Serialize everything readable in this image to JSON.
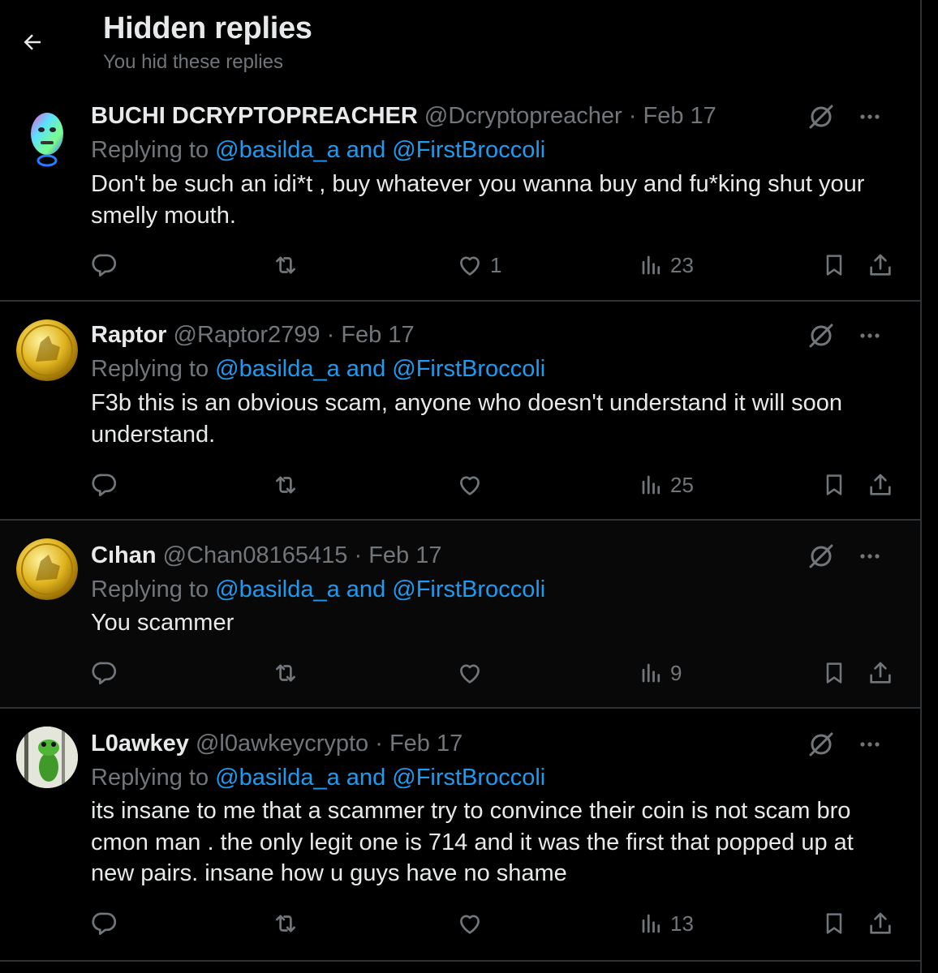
{
  "header": {
    "title": "Hidden replies",
    "subtitle": "You hid these replies",
    "back_icon": "arrow-left-icon"
  },
  "colors": {
    "background": "#000000",
    "text": "#e7e9ea",
    "muted": "#71767b",
    "link": "#1d9bf0",
    "divider": "#2f3336"
  },
  "replies": [
    {
      "name": "BUCHI DCRYPTOPREACHER",
      "handle": "@Dcryptopreacher",
      "separator": "·",
      "date": "Feb 17",
      "replying_prefix": "Replying to",
      "replying_to": "@basilda_a and @FirstBroccoli",
      "text": "Don't be such an idi*t , buy whatever you wanna buy and fu*king shut your smelly mouth.",
      "likes": "1",
      "views": "23",
      "avatar": "3d-character-avatar"
    },
    {
      "name": "Raptor",
      "handle": "@Raptor2799",
      "separator": "·",
      "date": "Feb 17",
      "replying_prefix": "Replying to",
      "replying_to": "@basilda_a and @FirstBroccoli",
      "text": "F3b this is an obvious scam, anyone who doesn't understand it will soon understand.",
      "likes": "",
      "views": "25",
      "avatar": "gold-coin-avatar"
    },
    {
      "name": "Cıhan",
      "handle": "@Chan08165415",
      "separator": "·",
      "date": "Feb 17",
      "replying_prefix": "Replying to",
      "replying_to": "@basilda_a and @FirstBroccoli",
      "text": "You scammer",
      "likes": "",
      "views": "9",
      "avatar": "gold-coin-avatar"
    },
    {
      "name": "L0awkey",
      "handle": "@l0awkeycrypto",
      "separator": "·",
      "date": "Feb 17",
      "replying_prefix": "Replying to",
      "replying_to": "@basilda_a and @FirstBroccoli",
      "text": "its insane to me that a scammer try to convince their coin is not scam bro cmon man . the only legit one is 714 and it was the first that popped up at new pairs. insane how u guys have no shame",
      "likes": "",
      "views": "13",
      "avatar": "frog-avatar"
    }
  ],
  "icons": {
    "hide": "hide-reply-icon",
    "more": "more-dots-icon",
    "reply": "reply-bubble-icon",
    "repost": "repost-icon",
    "like": "heart-icon",
    "views": "views-bars-icon",
    "bookmark": "bookmark-icon",
    "share": "share-icon"
  }
}
